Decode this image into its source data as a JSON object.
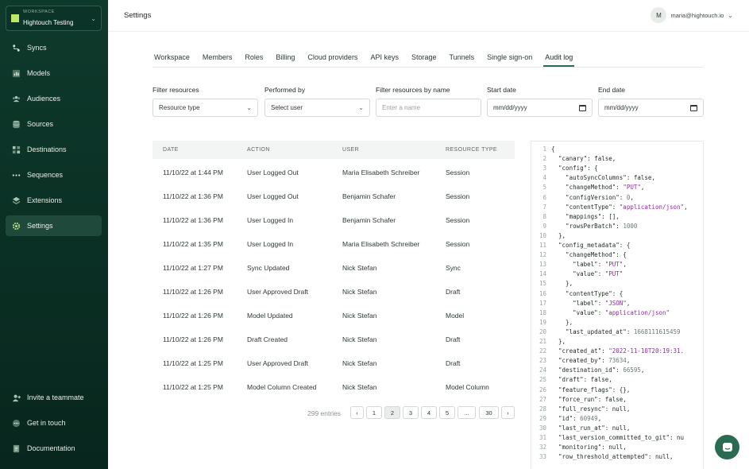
{
  "workspace": {
    "caption": "WORKSPACE",
    "name": "Hightouch Testing"
  },
  "sidebar": {
    "items": [
      {
        "label": "Syncs",
        "icon": "syncs-icon"
      },
      {
        "label": "Models",
        "icon": "models-icon"
      },
      {
        "label": "Audiences",
        "icon": "audiences-icon"
      },
      {
        "label": "Sources",
        "icon": "sources-icon"
      },
      {
        "label": "Destinations",
        "icon": "destinations-icon"
      },
      {
        "label": "Sequences",
        "icon": "sequences-icon"
      },
      {
        "label": "Extensions",
        "icon": "extensions-icon"
      },
      {
        "label": "Settings",
        "icon": "settings-icon",
        "active": true
      }
    ],
    "bottom": [
      {
        "label": "Invite a teammate",
        "icon": "invite-icon"
      },
      {
        "label": "Get in touch",
        "icon": "chat-bubble-icon"
      },
      {
        "label": "Documentation",
        "icon": "docs-icon"
      }
    ]
  },
  "header": {
    "title": "Settings",
    "avatar_initial": "M",
    "user_email": "maria@hightouch.io"
  },
  "tabs": [
    "Workspace",
    "Members",
    "Roles",
    "Billing",
    "Cloud providers",
    "API keys",
    "Storage",
    "Tunnels",
    "Single sign-on",
    "Audit log"
  ],
  "active_tab": "Audit log",
  "filters": {
    "resources": {
      "label": "Filter resources",
      "value": "Resource type"
    },
    "performed_by": {
      "label": "Performed by",
      "value": "Select user"
    },
    "name": {
      "label": "Filter resources by name",
      "placeholder": "Enter a name"
    },
    "start_date": {
      "label": "Start date",
      "placeholder": "mm/dd/yyyy"
    },
    "end_date": {
      "label": "End date",
      "placeholder": "mm/dd/yyyy"
    }
  },
  "table": {
    "columns": [
      "DATE",
      "ACTION",
      "USER",
      "RESOURCE TYPE"
    ],
    "rows": [
      [
        "11/10/22 at 1:44 PM",
        "User Logged Out",
        "Maria Elisabeth Schreiber",
        "Session"
      ],
      [
        "11/10/22 at 1:36 PM",
        "User Logged Out",
        "Benjamin Schafer",
        "Session"
      ],
      [
        "11/10/22 at 1:36 PM",
        "User Logged In",
        "Benjamin Schafer",
        "Session"
      ],
      [
        "11/10/22 at 1:35 PM",
        "User Logged In",
        "Maria Elisabeth Schreiber",
        "Session"
      ],
      [
        "11/10/22 at 1:27 PM",
        "Sync Updated",
        "Nick Stefan",
        "Sync"
      ],
      [
        "11/10/22 at 1:26 PM",
        "User Approved Draft",
        "Nick Stefan",
        "Draft"
      ],
      [
        "11/10/22 at 1:26 PM",
        "Model Updated",
        "Nick Stefan",
        "Model"
      ],
      [
        "11/10/22 at 1:26 PM",
        "Draft Created",
        "Nick Stefan",
        "Draft"
      ],
      [
        "11/10/22 at 1:25 PM",
        "User Approved Draft",
        "Nick Stefan",
        "Draft"
      ],
      [
        "11/10/22 at 1:25 PM",
        "Model Column Created",
        "Nick Stefan",
        "Model Column"
      ]
    ]
  },
  "pagination": {
    "entries": "299 entries",
    "prev": "‹",
    "next": "›",
    "pages": [
      "1",
      "2",
      "3",
      "4",
      "5",
      "...",
      "30"
    ],
    "current": "2"
  },
  "code_lines": [
    "{",
    "  \"canary\": false,",
    "  \"config\": {",
    "    \"autoSyncColumns\": false,",
    "    \"changeMethod\": \"PUT\",",
    "    \"configVersion\": 0,",
    "    \"contentType\": \"application/json\",",
    "    \"mappings\": [],",
    "    \"rowsPerBatch\": 1000",
    "  },",
    "  \"config_metadata\": {",
    "    \"changeMethod\": {",
    "      \"label\": \"PUT\",",
    "      \"value\": \"PUT\"",
    "    },",
    "    \"contentType\": {",
    "      \"label\": \"JSON\",",
    "      \"value\": \"application/json\"",
    "    },",
    "    \"last_updated_at\": 1668111615459",
    "  },",
    "  \"created_at\": \"2022-11-10T20:19:31.",
    "  \"created_by\": 73634,",
    "  \"destination_id\": 66595,",
    "  \"draft\": false,",
    "  \"feature_flags\": {},",
    "  \"force_run\": false,",
    "  \"full_resync\": null,",
    "  \"id\": 60949,",
    "  \"last_run_at\": null,",
    "  \"last_version_committed_to_git\": nu",
    "  \"monitoring\": null,",
    "  \"row_threshold_attempted\": null,"
  ],
  "colors": {
    "sidebar_bg": "#0b3125",
    "accent": "#2e6a55",
    "logo": "#bfe86a",
    "string": "#8b2da0"
  }
}
